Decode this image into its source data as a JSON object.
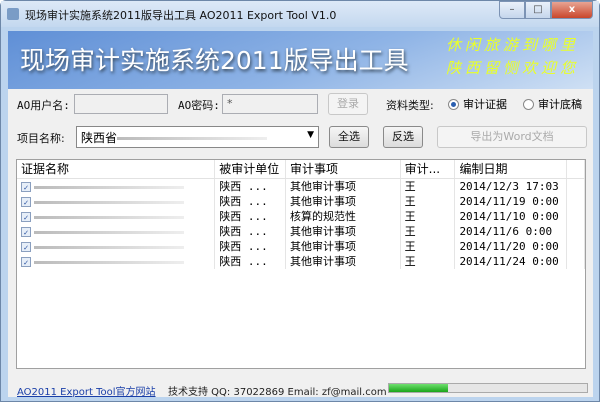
{
  "window": {
    "title": "现场审计实施系统2011版导出工具 AO2011 Export Tool V1.0",
    "min": "–",
    "max": "□",
    "close": "x"
  },
  "banner": {
    "title": "现场审计实施系统2011版导出工具",
    "slogan1": "休闲旅游到哪里",
    "slogan2": "陕西留恻欢迎您"
  },
  "form": {
    "user_label": "AO用户名:",
    "password_label": "AO密码:",
    "password_value": "*",
    "login": "登录",
    "type_label": "资料类型:",
    "type_options": [
      "审计证据",
      "审计底稿"
    ],
    "project_label": "项目名称:",
    "project_value": "陕西省",
    "select_all": "全选",
    "invert": "反选",
    "export": "导出为Word文档"
  },
  "table": {
    "headers": [
      "证据名称",
      "被审计单位",
      "审计事项",
      "审计...",
      "编制日期"
    ],
    "rows": [
      {
        "unit": "陕西 ...",
        "item": "其他审计事项",
        "auditor": "王",
        "date": "2014/12/3 17:03"
      },
      {
        "unit": "陕西 ...",
        "item": "其他审计事项",
        "auditor": "王",
        "date": "2014/11/19 0:00"
      },
      {
        "unit": "陕西 ...",
        "item": "核算的规范性",
        "auditor": "王",
        "date": "2014/11/10 0:00"
      },
      {
        "unit": "陕西 ...",
        "item": "其他审计事项",
        "auditor": "王",
        "date": "2014/11/6 0:00"
      },
      {
        "unit": "陕西 ...",
        "item": "其他审计事项",
        "auditor": "王",
        "date": "2014/11/20 0:00"
      },
      {
        "unit": "陕西 ...",
        "item": "其他审计事项",
        "auditor": "王",
        "date": "2014/11/24 0:00"
      }
    ]
  },
  "status": {
    "link": "AO2011 Export Tool官方网站",
    "support": "技术支持 QQ: 37022869  Email: zf@mail.com",
    "progress_percent": 30
  }
}
